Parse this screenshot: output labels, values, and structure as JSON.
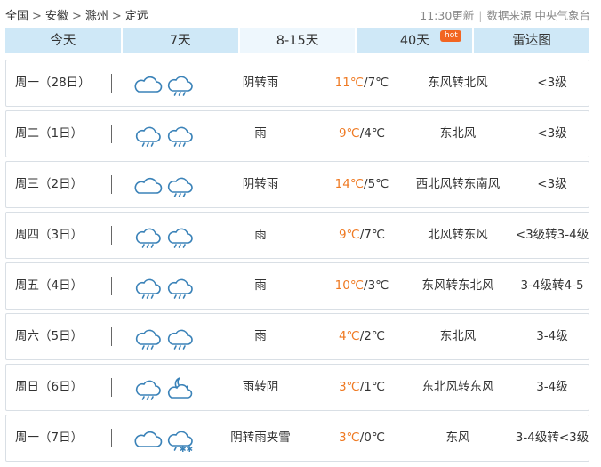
{
  "breadcrumb": [
    "全国",
    "安徽",
    "滁州",
    "定远"
  ],
  "breadcrumb_sep": ">",
  "update_time": "11:30更新",
  "source": "数据来源 中央气象台",
  "tabs": [
    {
      "label": "今天",
      "active": false
    },
    {
      "label": "7天",
      "active": false
    },
    {
      "label": "8-15天",
      "active": true
    },
    {
      "label": "40天",
      "active": false,
      "badge": "hot"
    },
    {
      "label": "雷达图",
      "active": false
    }
  ],
  "colors": {
    "high_temp": "#ef7a23",
    "tab_bg": "#cfe8f7",
    "icon_stroke": "#3a82b8",
    "hot_badge": "#f26522"
  },
  "forecast": [
    {
      "day": "周一（28日）",
      "icons": [
        "cloudy-icon",
        "rain-icon"
      ],
      "condition": "阴转雨",
      "high": "11℃",
      "low": "/7℃",
      "wind_dir": "东风转北风",
      "wind_level": "<3级"
    },
    {
      "day": "周二（1日）",
      "icons": [
        "rain-icon",
        "rain-icon"
      ],
      "condition": "雨",
      "high": "9℃",
      "low": "/4℃",
      "wind_dir": "东北风",
      "wind_level": "<3级"
    },
    {
      "day": "周三（2日）",
      "icons": [
        "cloudy-icon",
        "rain-icon"
      ],
      "condition": "阴转雨",
      "high": "14℃",
      "low": "/5℃",
      "wind_dir": "西北风转东南风",
      "wind_level": "<3级"
    },
    {
      "day": "周四（3日）",
      "icons": [
        "rain-icon",
        "rain-icon"
      ],
      "condition": "雨",
      "high": "9℃",
      "low": "/7℃",
      "wind_dir": "北风转东风",
      "wind_level": "<3级转3-4级"
    },
    {
      "day": "周五（4日）",
      "icons": [
        "rain-icon",
        "rain-icon"
      ],
      "condition": "雨",
      "high": "10℃",
      "low": "/3℃",
      "wind_dir": "东风转东北风",
      "wind_level": "3-4级转4-5"
    },
    {
      "day": "周六（5日）",
      "icons": [
        "rain-icon",
        "rain-icon"
      ],
      "condition": "雨",
      "high": "4℃",
      "low": "/2℃",
      "wind_dir": "东北风",
      "wind_level": "3-4级"
    },
    {
      "day": "周日（6日）",
      "icons": [
        "rain-icon",
        "partly-cloudy-night-icon"
      ],
      "condition": "雨转阴",
      "high": "3℃",
      "low": "/1℃",
      "wind_dir": "东北风转东风",
      "wind_level": "3-4级"
    },
    {
      "day": "周一（7日）",
      "icons": [
        "cloudy-icon",
        "sleet-icon"
      ],
      "condition": "阴转雨夹雪",
      "high": "3℃",
      "low": "/0℃",
      "wind_dir": "东风",
      "wind_level": "3-4级转<3级"
    }
  ]
}
